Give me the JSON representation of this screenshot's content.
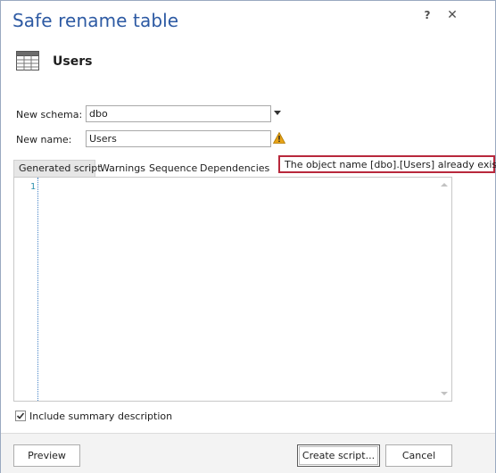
{
  "window": {
    "title": "Safe rename table",
    "help": "?",
    "close": "✕"
  },
  "object": {
    "name": "Users",
    "icon": "table-icon"
  },
  "form": {
    "schema_label": "New schema:",
    "schema_value": "dbo",
    "name_label": "New name:",
    "name_value": "Users",
    "warning_tooltip": "The object name [dbo].[Users] already exists"
  },
  "tabs": [
    {
      "label": "Generated script",
      "active": true
    },
    {
      "label": "Warnings",
      "active": false
    },
    {
      "label": "Sequence",
      "active": false
    },
    {
      "label": "Dependencies",
      "active": false
    }
  ],
  "editor": {
    "line_numbers": [
      "1"
    ]
  },
  "options": {
    "include_summary_label": "Include summary description",
    "include_summary_checked": true
  },
  "buttons": {
    "preview": "Preview",
    "create": "Create script...",
    "cancel": "Cancel"
  },
  "colors": {
    "title": "#2d5aa3",
    "tooltip_border": "#b8283c",
    "warning": "#e8a317",
    "line_number": "#2b91af"
  }
}
